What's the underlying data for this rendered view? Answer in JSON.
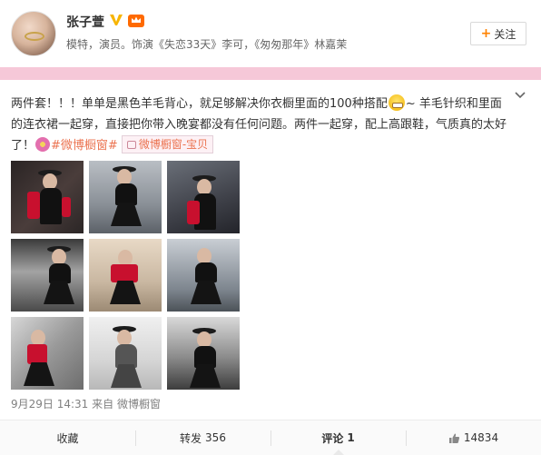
{
  "profile": {
    "name": "张子萱",
    "bio": "模特，演员。饰演《失恋33天》李可，《匆匆那年》林嘉茉",
    "follow_label": "关注",
    "follow_plus": "+"
  },
  "post": {
    "text_part1": "两件套！！！单单是黑色羊毛背心，就足够解决你衣橱里面的100种搭配",
    "text_part2": "~ 羊毛针织和里面的连衣裙一起穿，直接把你带入晚宴都没有任何问题。两件一起穿，配上高跟鞋，气质真的太好了！",
    "topic": "#微博橱窗#",
    "tag_label": "微博橱窗-宝贝",
    "icons": [
      "grin-emoji-icon",
      "flower-icon",
      "bag-icon",
      "chevron-down-icon"
    ]
  },
  "meta": {
    "time": "9月29日 14:31",
    "source_prefix": "来自",
    "source": "微博橱窗"
  },
  "actions": {
    "collect": "收藏",
    "repost_label": "转发",
    "repost_count": "356",
    "comment_label": "评论",
    "comment_count": "1",
    "like_count": "14834"
  },
  "colors": {
    "accent": "#eb7350",
    "pink_band": "#f6c8d8",
    "follow_plus": "#ff8200"
  }
}
